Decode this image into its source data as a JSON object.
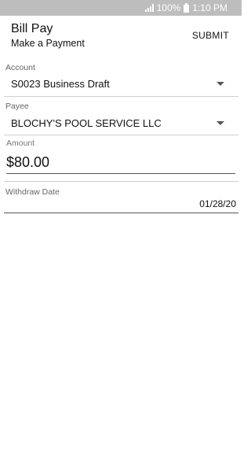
{
  "status_bar": {
    "battery_text": "100%",
    "time": "1:10 PM",
    "icons": [
      "signal-icon",
      "battery-icon"
    ]
  },
  "header": {
    "title": "Bill Pay",
    "subtitle": "Make a Payment",
    "submit_label": "SUBMIT"
  },
  "form": {
    "account": {
      "label": "Account",
      "value": "S0023 Business Draft"
    },
    "payee": {
      "label": "Payee",
      "value": "BLOCHY'S POOL SERVICE LLC"
    },
    "amount": {
      "label": "Amount",
      "value": "$80.00"
    },
    "withdraw_date": {
      "label": "Withdraw Date",
      "value": "01/28/20"
    }
  },
  "colors": {
    "status_bar_bg": "#bdbdbd",
    "text": "#111111",
    "label": "#666666",
    "divider": "#cfcfcf"
  }
}
